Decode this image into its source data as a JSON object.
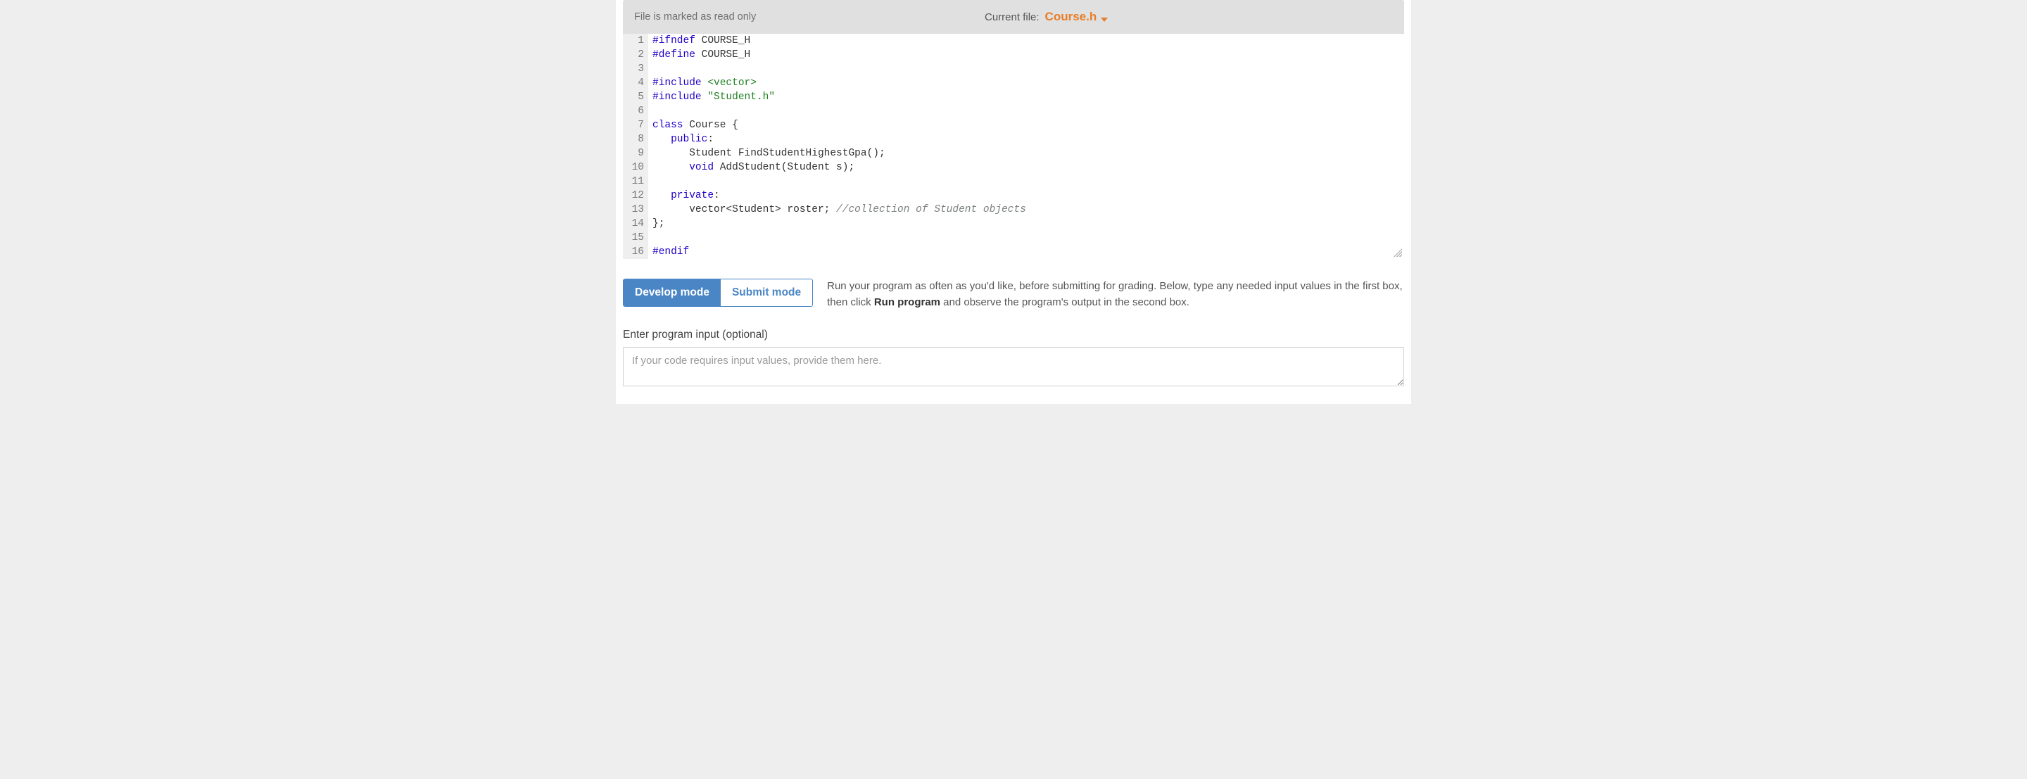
{
  "header": {
    "readonly_label": "File is marked as read only",
    "current_file_label": "Current file:",
    "current_file_name": "Course.h"
  },
  "code": {
    "lines": [
      {
        "n": 1,
        "tokens": [
          [
            "pp",
            "#ifndef"
          ],
          [
            "pn",
            " COURSE_H"
          ]
        ]
      },
      {
        "n": 2,
        "tokens": [
          [
            "pp",
            "#define"
          ],
          [
            "pn",
            " COURSE_H"
          ]
        ]
      },
      {
        "n": 3,
        "tokens": [
          [
            "pn",
            ""
          ]
        ]
      },
      {
        "n": 4,
        "tokens": [
          [
            "pp",
            "#include"
          ],
          [
            "pn",
            " "
          ],
          [
            "str",
            "<vector>"
          ]
        ]
      },
      {
        "n": 5,
        "tokens": [
          [
            "pp",
            "#include"
          ],
          [
            "pn",
            " "
          ],
          [
            "str",
            "\"Student.h\""
          ]
        ]
      },
      {
        "n": 6,
        "tokens": [
          [
            "pn",
            ""
          ]
        ]
      },
      {
        "n": 7,
        "tokens": [
          [
            "kw",
            "class"
          ],
          [
            "pn",
            " Course {"
          ]
        ]
      },
      {
        "n": 8,
        "tokens": [
          [
            "pn",
            "   "
          ],
          [
            "kw",
            "public"
          ],
          [
            "pn",
            ":"
          ]
        ]
      },
      {
        "n": 9,
        "tokens": [
          [
            "pn",
            "      Student FindStudentHighestGpa();"
          ]
        ]
      },
      {
        "n": 10,
        "tokens": [
          [
            "pn",
            "      "
          ],
          [
            "kw",
            "void"
          ],
          [
            "pn",
            " AddStudent(Student s);"
          ]
        ]
      },
      {
        "n": 11,
        "tokens": [
          [
            "pn",
            ""
          ]
        ]
      },
      {
        "n": 12,
        "tokens": [
          [
            "pn",
            "   "
          ],
          [
            "kw",
            "private"
          ],
          [
            "pn",
            ":"
          ]
        ]
      },
      {
        "n": 13,
        "tokens": [
          [
            "pn",
            "      vector<Student> roster; "
          ],
          [
            "cm",
            "//collection of Student objects"
          ]
        ]
      },
      {
        "n": 14,
        "tokens": [
          [
            "pn",
            "};"
          ]
        ]
      },
      {
        "n": 15,
        "tokens": [
          [
            "pn",
            ""
          ]
        ]
      },
      {
        "n": 16,
        "tokens": [
          [
            "pp",
            "#endif"
          ]
        ]
      }
    ]
  },
  "modes": {
    "develop_label": "Develop mode",
    "submit_label": "Submit mode",
    "help_pre": "Run your program as often as you'd like, before submitting for grading. Below, type any needed input values in the first box, then click ",
    "help_bold": "Run program",
    "help_post": " and observe the program's output in the second box."
  },
  "input": {
    "label": "Enter program input (optional)",
    "placeholder": "If your code requires input values, provide them here."
  }
}
